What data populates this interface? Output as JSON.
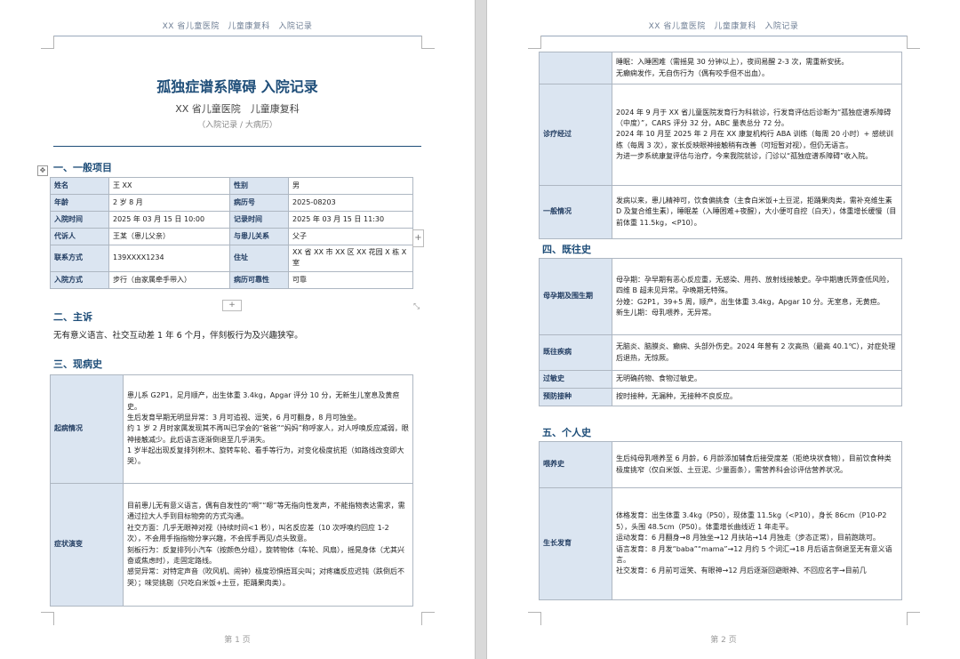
{
  "header": "XX 省儿童医院　儿童康复科　入院记录",
  "page1": {
    "title": "孤独症谱系障碍 入院记录",
    "hospital": "XX 省儿童医院　儿童康复科",
    "doc_type": "（入院记录 / 大病历）",
    "footer": "第 1 页",
    "controls": {
      "move": "✥",
      "add_col": "+",
      "add_row": "+",
      "resize": "⤡"
    },
    "sec1": "一、一般项目",
    "general": [
      [
        "姓名",
        "王 XX",
        "性别",
        "男"
      ],
      [
        "年龄",
        "2 岁 8 月",
        "病历号",
        "2025-08203"
      ],
      [
        "入院时间",
        "2025 年 03 月 15 日 10:00",
        "记录时间",
        "2025 年 03 月 15 日 11:30"
      ],
      [
        "代诉人",
        "王某（患儿父亲）",
        "与患儿关系",
        "父子"
      ],
      [
        "联系方式",
        "139XXXX1234",
        "住址",
        "XX 省 XX 市 XX 区 XX 花园 X 栋 X 室"
      ],
      [
        "入院方式",
        "步行（由家属牵手带入）",
        "病历可靠性",
        "可靠"
      ]
    ],
    "sec2": "二、主诉",
    "complaint": "无有意义语言、社交互动差 1 年 6 个月，伴刻板行为及兴趣狭窄。",
    "sec3": "三、现病史",
    "hpi": [
      {
        "key": "起病情况",
        "lines": [
          "患儿系 G2P1，足月顺产，出生体重 3.4kg，Apgar 评分 10 分，无新生儿室息及黄疸史。",
          "生后发育早期无明显异常：3 月可追视、逗笑，6 月可翻身，8 月可独坐。",
          "约 1 岁 2 月时家属发现其不再叫已学会的“爸爸”“妈妈”称呼家人，对人呼唤反应减弱，眼神接触减少。此后语言逐渐倒退至几乎消失。",
          "1 岁半起出现反复排列积木、旋转车轮、看手等行为，对变化极度抗拒（如路线改变即大哭）。"
        ]
      },
      {
        "key": "症状演变",
        "lines": [
          "目前患儿无有意义语言，偶有自发性的“啊”“嗯”等无指向性发声，不能指物表达需求，需通过拉大人手到目标物旁的方式沟通。",
          "社交方面：几乎无眼神对视（持续时间<1 秒），叫名反应差（10 次呼唤约回应 1-2 次），不会用手指指物分享兴趣，不会挥手再见/点头致意。",
          "刻板行为：反复排列小汽车（按颜色分组），旋转物体（车轮、风扇），摇晃身体（尤其兴奋或焦虑时），走固定路线。",
          "感觉异常：对特定声音（吹风机、闹钟）极度恐惧捂耳尖叫；对疼痛反应迟钝（跌倒后不哭）；味觉挑剔（只吃白米饭+土豆，拒踊果肉类）。"
        ]
      }
    ]
  },
  "page2": {
    "footer": "第 2 页",
    "table1": [
      {
        "key": "",
        "lines": [
          "睡眠：入睡困难（需摇晃 30 分钟以上），夜间易醒 2-3 次，需重新安抚。",
          "无癫痫发作，无自伤行为（偶有咬手但不出血）。"
        ]
      },
      {
        "key": "诊疗经过",
        "lines": [
          "2024 年 9 月于 XX 省儿童医院发育行为科就诊，行发育评估后诊断为“孤独症谱系障碍（中度）”，CARS 评分 32 分，ABC 量表总分 72 分。",
          "2024 年 10 月至 2025 年 2 月在 XX 康复机构行 ABA 训练（每周 20 小时）+ 感统训练（每周 3 次），家长反映眼神接触稍有改善（可短暂对视），但仍无语言。",
          "为进一步系统康复评估与治疗，今来我院就诊，门诊以“孤独症谱系障碍”收入院。"
        ]
      },
      {
        "key": "一般情况",
        "lines": [
          "发病以来，患儿精神可，饮食偏挑食（主食白米饭+土豆泥，拒踊果肉类，需补充维生素 D 及复合维生素），睡眠差（入睡困难+夜醒），大小便可自控（白天），体重增长缓慢（目前体重 11.5kg，<P10）。"
        ]
      }
    ],
    "sec4": "四、既往史",
    "table2": [
      {
        "key": "母孕期及围生期",
        "lines": [
          "母孕期：孕早期有恶心反应重，无感染、用药、放射线接触史。孕中期唐氏筛查低风险，四维 B 超未见异常。孕晚期无特殊。",
          "分娩：G2P1，39+5 周，顺产，出生体重 3.4kg，Apgar 10 分。无室息，无黄疸。",
          "新生儿期：母乳喂养，无异常。"
        ]
      },
      {
        "key": "既往疾病",
        "lines": [
          "无脑炎、脑膜炎、癫痫、头部外伤史。2024 年曾有 2 次高热（最高 40.1℃），对症处理后退热，无惊厥。"
        ]
      },
      {
        "key": "过敏史",
        "lines": [
          "无明确药物、食物过敏史。"
        ]
      },
      {
        "key": "预防接种",
        "lines": [
          "按时接种，无漏种，无接种不良反应。"
        ]
      }
    ],
    "sec5": "五、个人史",
    "table3": [
      {
        "key": "喂养史",
        "lines": [
          "生后纯母乳喂养至 6 月龄，6 月龄添加辅食后接受度差（拒绝块状食物），目前饮食种类极度挑窄（仅白米饭、土豆泥、少量面条），需营养科会诊评估营养状况。"
        ]
      },
      {
        "key": "生长发育",
        "lines": [
          "体格发育：出生体重 3.4kg（P50），现体重 11.5kg（<P10），身长 86cm（P10-P25），头围 48.5cm（P50）。体重增长曲线近 1 年走平。",
          "运动发育：6 月翻身→8 月独坐→12 月扶站→14 月独走（步态正常），目前跑跳可。",
          "语言发育：8 月发“baba”“mama”→12 月约 5 个词汇→18 月后语言倒退至无有意义语言。",
          "社交发育：6 月前可逗笑、有眼神→12 月后逐渐回避眼神、不回应名字→目前几"
        ]
      }
    ]
  }
}
